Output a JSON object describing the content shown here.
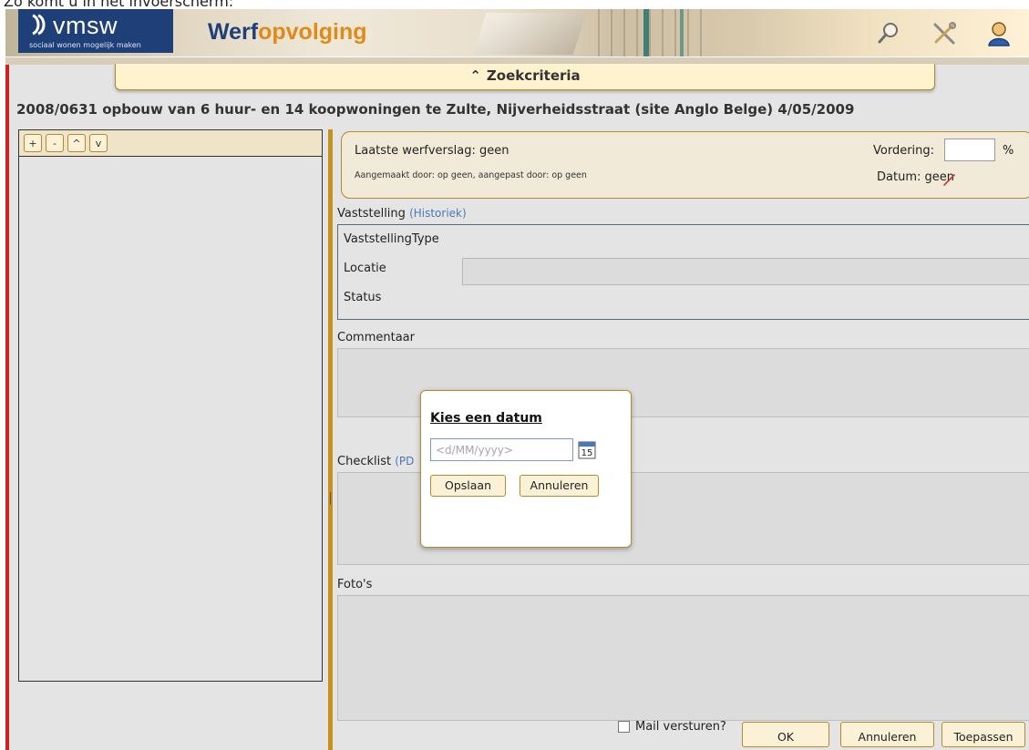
{
  "caption": "Zo komt u in het invoerscherm:",
  "header": {
    "logo_mark": "ᵴ",
    "logo_text": "vmsw",
    "logo_sub": "sociaal wonen mogelijk maken",
    "title_part1": "Werf",
    "title_part2": "opvolging",
    "icons": [
      "search-icon",
      "tools-icon",
      "user-icon"
    ]
  },
  "search_bar": {
    "chevron": "⌃",
    "label": "Zoekcriteria"
  },
  "project_title": "2008/0631 opbouw van 6 huur- en 14 koopwoningen te Zulte, Nijverheidsstraat (site Anglo Belge) 4/05/2009",
  "tree_toolbar": {
    "add": "+",
    "remove": "-",
    "up": "^",
    "down": "v"
  },
  "summary": {
    "laatste": "Laatste werfverslag: geen",
    "aangemaakt": "Aangemaakt door:  op geen, aangepast door:  op geen",
    "vordering_label": "Vordering:",
    "vordering_value": "",
    "percent": "%",
    "datum_label": "Datum: geen"
  },
  "vaststelling": {
    "label": "Vaststelling",
    "history_link": "(Historiek)",
    "type_label": "VaststellingType",
    "locatie_label": "Locatie",
    "status_label": "Status"
  },
  "commentaar_label": "Commentaar",
  "checklist": {
    "label": "Checklist",
    "link": "(PD"
  },
  "fotos_label": "Foto's",
  "footer": {
    "mail_label": "Mail versturen?",
    "ok": "OK",
    "annuleren": "Annuleren",
    "toepassen": "Toepassen"
  },
  "dialog": {
    "title": "Kies een datum",
    "date_placeholder": "<d/MM/yyyy>",
    "calendar_day": "15",
    "save": "Opslaan",
    "cancel": "Annuleren"
  },
  "colors": {
    "brand_blue": "#1e3f78",
    "brand_orange": "#e08a18",
    "accent_gold": "#c6921d",
    "frame_red": "#d21f1f"
  }
}
